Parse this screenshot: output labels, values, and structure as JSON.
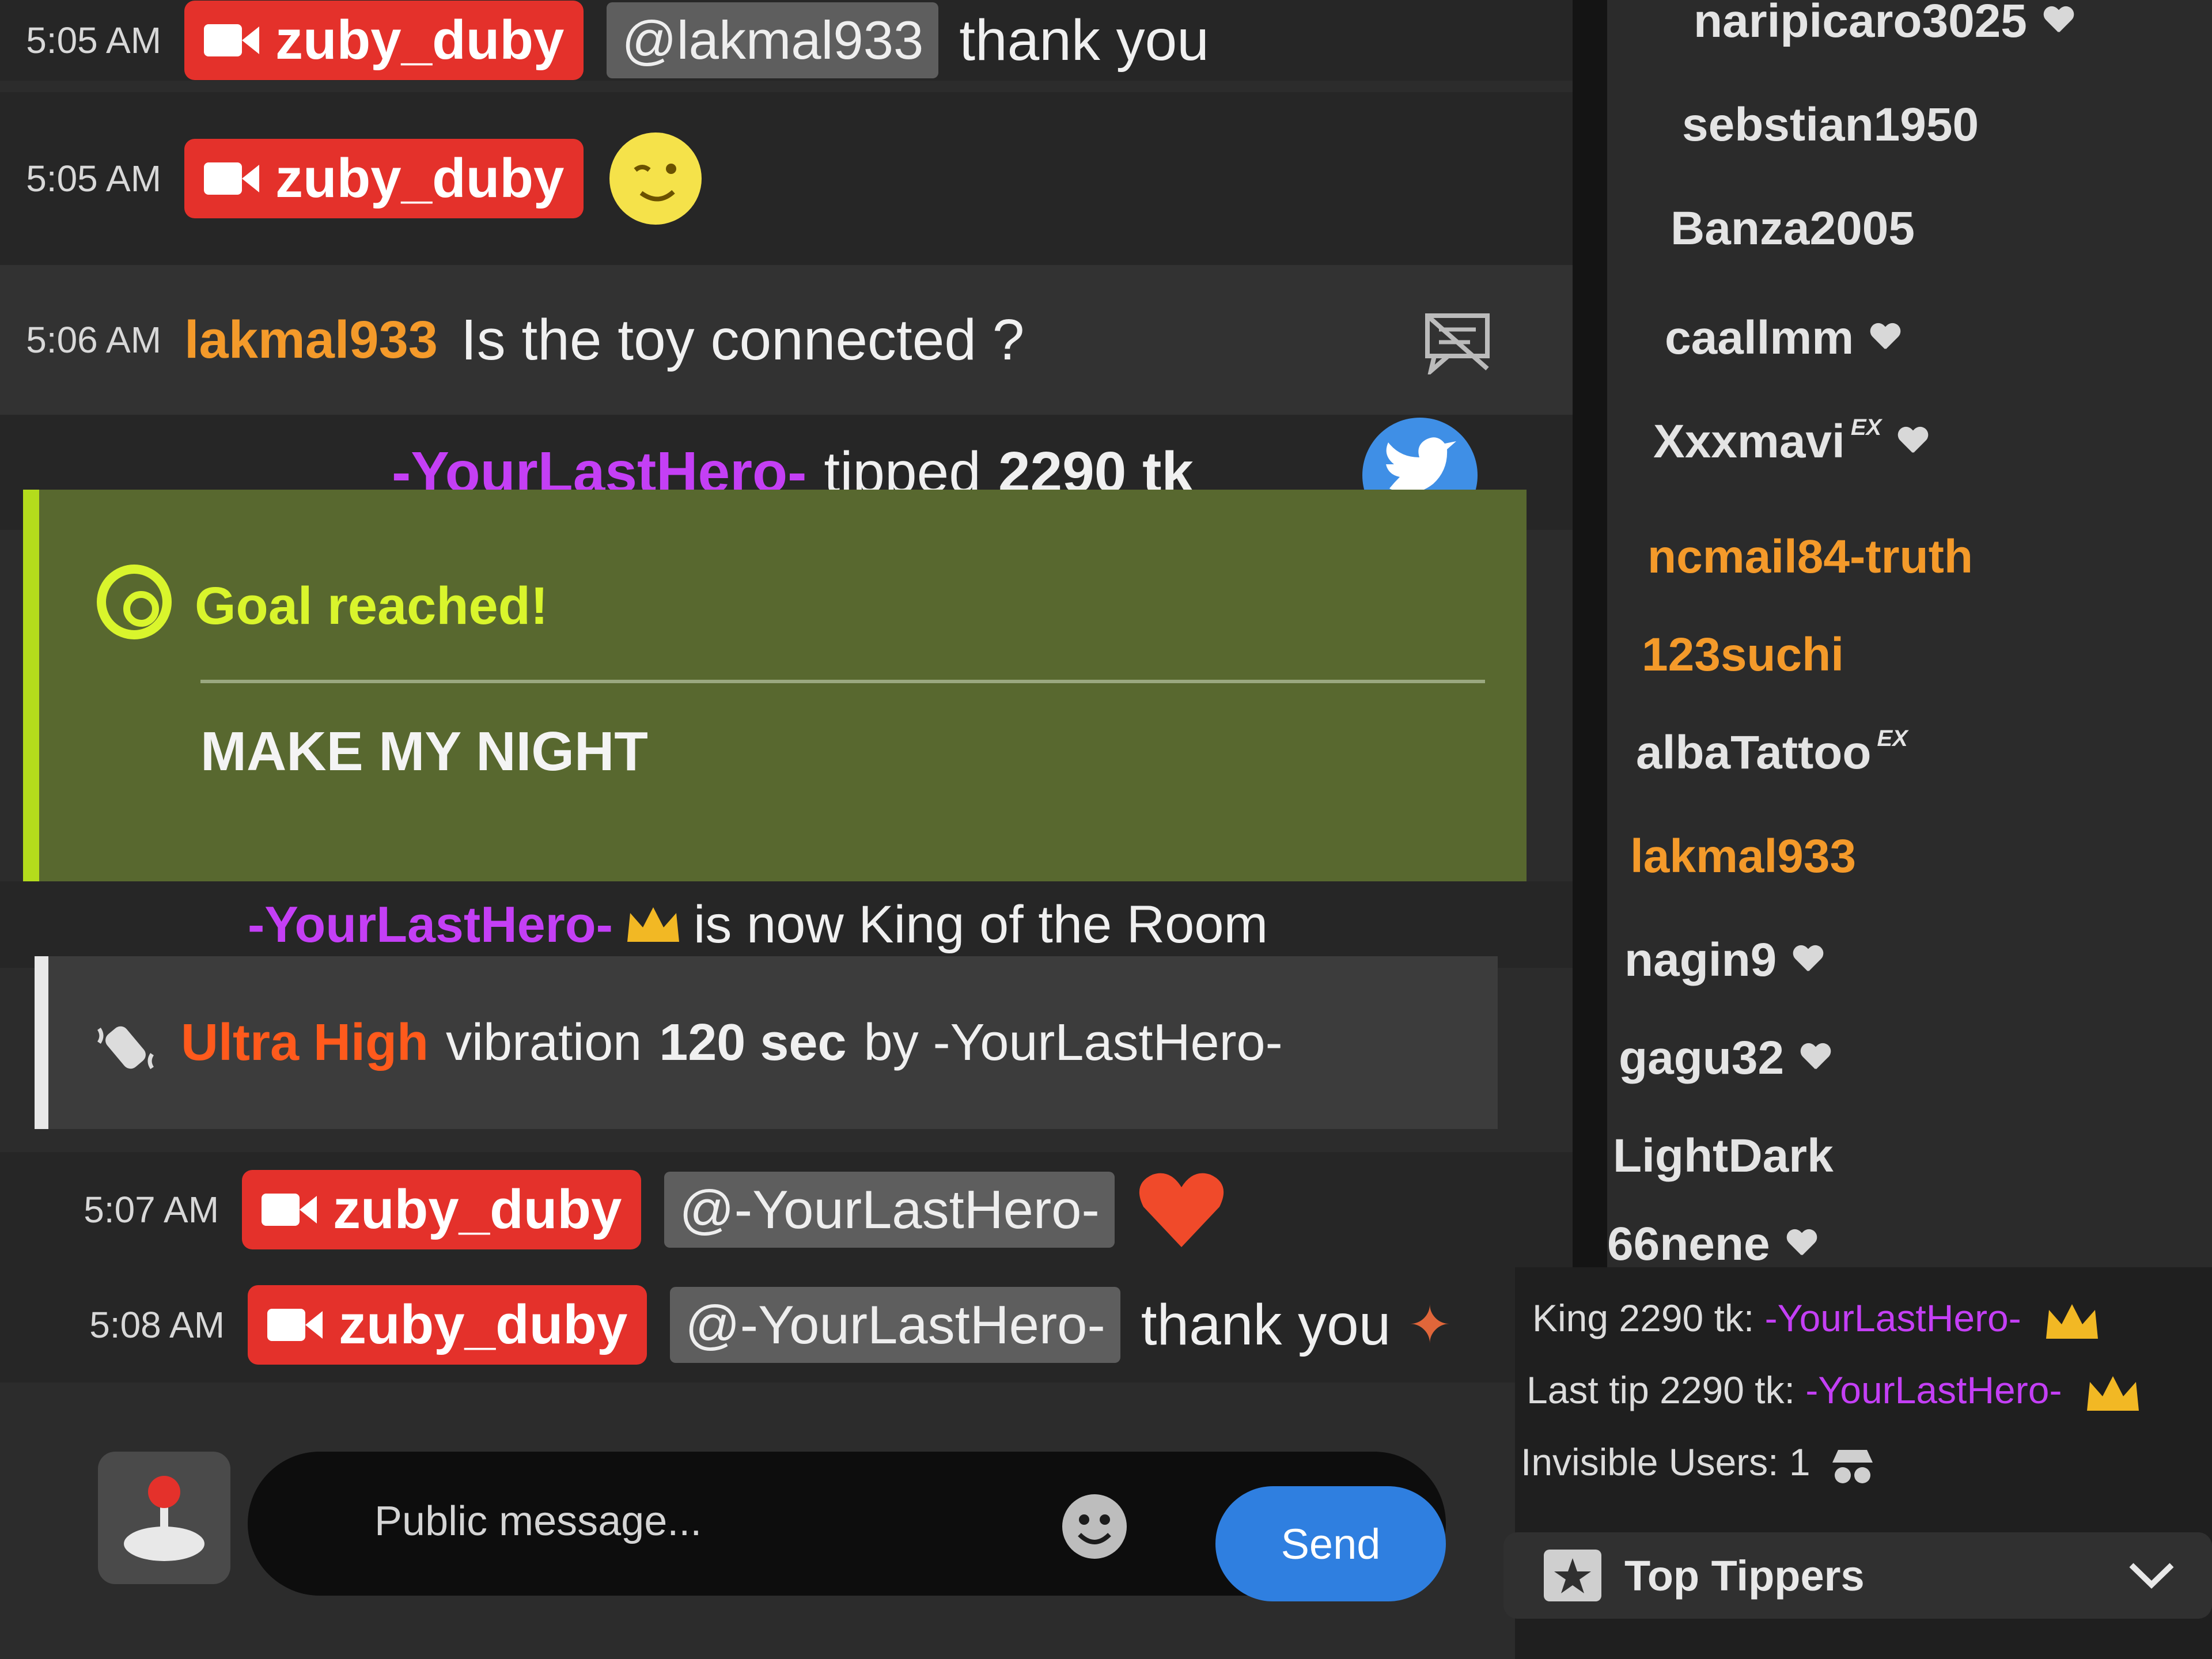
{
  "chat": {
    "messages": [
      {
        "time": "5:05 AM",
        "user": "zuby_duby",
        "mention": "@lakmal933",
        "text": "thank you"
      },
      {
        "time": "5:05 AM",
        "user": "zuby_duby",
        "emoji": "wink"
      },
      {
        "time": "5:06 AM",
        "user": "lakmal933",
        "text": "Is the toy connected ?"
      },
      {
        "time": "5:07 AM",
        "user": "zuby_duby",
        "mention": "@-YourLastHero-",
        "emoji": "heart"
      },
      {
        "time": "5:08 AM",
        "user": "zuby_duby",
        "mention": "@-YourLastHero-",
        "text": "thank you"
      }
    ],
    "tip": {
      "user": "-YourLastHero-",
      "verb": "tipped",
      "amount": "2290 tk"
    },
    "goal": {
      "title": "Goal reached!",
      "text": "MAKE MY NIGHT"
    },
    "king": {
      "user": "-YourLastHero-",
      "text": "is now King of the Room"
    },
    "vibration": {
      "level": "Ultra High",
      "text1": "vibration",
      "duration": "120 sec",
      "text2": "by -YourLastHero-"
    },
    "input": {
      "placeholder": "Public message...",
      "send": "Send"
    }
  },
  "sidebar": {
    "viewers": [
      {
        "name": "naripicaro3025",
        "heart": true,
        "color": "#e4e4e4"
      },
      {
        "name": "sebstian1950",
        "heart": false,
        "color": "#e4e4e4"
      },
      {
        "name": "Banza2005",
        "heart": false,
        "color": "#e4e4e4"
      },
      {
        "name": "caallmm",
        "heart": true,
        "color": "#e4e4e4"
      },
      {
        "name": "Xxxmavi",
        "ex": "EX",
        "heart": true,
        "color": "#e4e4e4"
      },
      {
        "name": "ncmail84-truth",
        "heart": false,
        "color": "#f49a2a"
      },
      {
        "name": "123suchi",
        "heart": false,
        "color": "#f49a2a"
      },
      {
        "name": "albaTattoo",
        "ex": "EX",
        "heart": false,
        "color": "#e4e4e4"
      },
      {
        "name": "lakmal933",
        "heart": false,
        "color": "#f49a2a"
      },
      {
        "name": "nagin9",
        "heart": true,
        "color": "#e4e4e4"
      },
      {
        "name": "gagu32",
        "heart": true,
        "color": "#e4e4e4"
      },
      {
        "name": "LightDark",
        "heart": false,
        "color": "#e4e4e4"
      },
      {
        "name": "66nene",
        "heart": true,
        "color": "#e4e4e4"
      }
    ],
    "stats": {
      "king_label": "King 2290 tk:",
      "king_user": "-YourLastHero-",
      "last_tip_label": "Last tip 2290 tk:",
      "last_tip_user": "-YourLastHero-",
      "invisible_label": "Invisible Users:",
      "invisible_count": "1"
    },
    "top_tippers": "Top Tippers"
  },
  "colors": {
    "badge": "#e4312b",
    "purple": "#c43ff5",
    "orange": "#f49a2a",
    "goal_bg": "#58682f",
    "goal_accent": "#d9f52c",
    "send": "#2f7fe0"
  }
}
